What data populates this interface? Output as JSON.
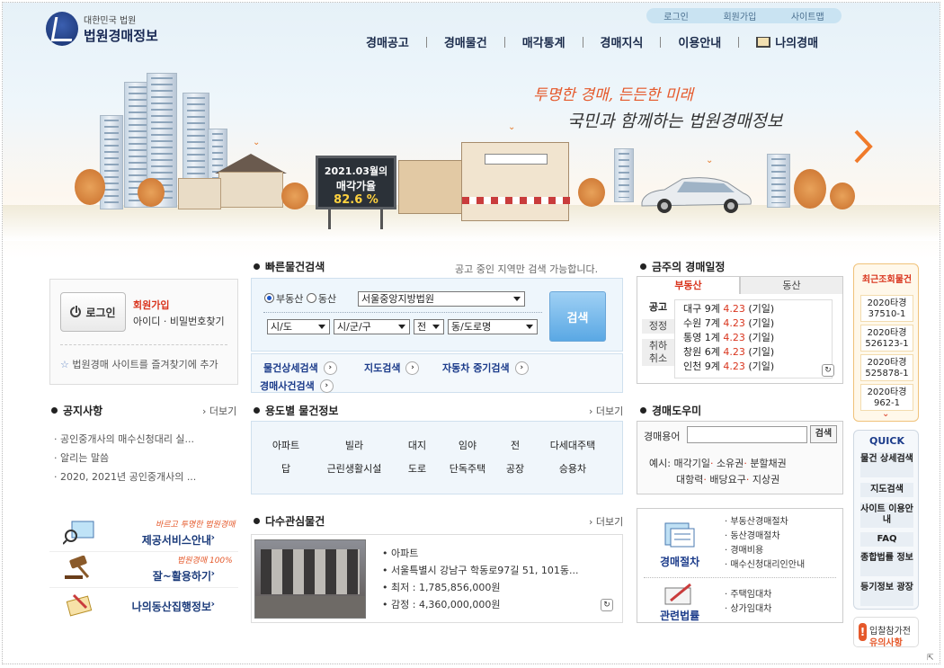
{
  "header": {
    "logo_sub": "대한민국 법원",
    "logo_main": "법원경매정보",
    "util": [
      "로그인",
      "회원가입",
      "사이트맵"
    ],
    "nav": [
      "경매공고",
      "경매물건",
      "매각통계",
      "경매지식",
      "이용안내",
      "나의경매"
    ],
    "slogan1": "투명한 경매, 든든한 미래",
    "slogan2": "국민과 함께하는 법원경매정보",
    "billboard": {
      "line1": "2021.03월의",
      "line2": "매각가율",
      "rate": "82.6 %"
    }
  },
  "login": {
    "button": "로그인",
    "join": "회원가입",
    "find": "아이디 · 비밀번호찾기",
    "favorite": "법원경매 사이트를 즐겨찾기에 추가"
  },
  "notice": {
    "title": "공지사항",
    "more": "더보기",
    "items": [
      "공인중개사의 매수신청대리 실...",
      "알리는 말씀",
      "2020, 2021년 공인중개사의 ..."
    ]
  },
  "services": [
    {
      "slogan": "바르고 투명한 법원경매",
      "title": "제공서비스안내"
    },
    {
      "slogan": "법원경매 100%",
      "title": "잘~활용하기"
    },
    {
      "slogan": "",
      "title": "나의동산집행정보"
    }
  ],
  "quick_search": {
    "title": "빠른물건검색",
    "note": "공고 중인 지역만 검색 가능합니다.",
    "radio": [
      "부동산",
      "동산"
    ],
    "court": "서울중앙지방법원",
    "sido": "시/도",
    "sigungu": "시/군/구",
    "jeon": "전",
    "dong": "동/도로명",
    "button": "검색",
    "links": [
      "물건상세검색",
      "지도검색",
      "자동차 중기검색",
      "경매사건검색"
    ]
  },
  "usage": {
    "title": "용도별 물건정보",
    "more": "더보기",
    "row1": [
      "아파트",
      "빌라",
      "대지",
      "임야",
      "전",
      "다세대주택"
    ],
    "row2": [
      "답",
      "근린생활시설",
      "도로",
      "단독주택",
      "공장",
      "승용차"
    ]
  },
  "popular": {
    "title": "다수관심물건",
    "more": "더보기",
    "info": [
      "아파트",
      "서울특별시 강남구 학동로97길 51, 101동...",
      "최저 : 1,785,856,000원",
      "감정 : 4,360,000,000원"
    ]
  },
  "schedule": {
    "title": "금주의 경매일정",
    "tabs": [
      "부동산",
      "동산"
    ],
    "side": [
      "공고",
      "정정",
      "취하취소"
    ],
    "items": [
      {
        "place": "대구",
        "count": "9계",
        "date": "4.23",
        "day": "(기일)"
      },
      {
        "place": "수원",
        "count": "7계",
        "date": "4.23",
        "day": "(기일)"
      },
      {
        "place": "통영",
        "count": "1계",
        "date": "4.23",
        "day": "(기일)"
      },
      {
        "place": "창원",
        "count": "6계",
        "date": "4.23",
        "day": "(기일)"
      },
      {
        "place": "인천",
        "count": "9계",
        "date": "4.23",
        "day": "(기일)"
      }
    ]
  },
  "helper": {
    "title": "경매도우미",
    "label": "경매용어",
    "button": "검색",
    "example_label": "예시:",
    "terms": [
      "매각기일",
      "소유권",
      "분할채권",
      "대항력",
      "배당요구",
      "지상권"
    ]
  },
  "procedure": {
    "group1": "경매절차",
    "items1": [
      "부동산경매절차",
      "동산경매절차",
      "경매비용",
      "매수신청대리인안내"
    ],
    "group2": "관련법률",
    "items2": [
      "주택임대차",
      "상가임대차"
    ]
  },
  "recent": {
    "title": "최근조회물건",
    "items": [
      "2020타경 37510-1",
      "2020타경 526123-1",
      "2020타경 525878-1",
      "2020타경 962-1"
    ]
  },
  "quick": {
    "title": "QUICK",
    "items": [
      "물건 상세검색",
      "지도검색",
      "사이트 이용안내",
      "FAQ",
      "종합법률 정보",
      "등기정보 광장"
    ]
  },
  "caution": {
    "line1": "입찰참가전",
    "line2": "유의사항"
  }
}
